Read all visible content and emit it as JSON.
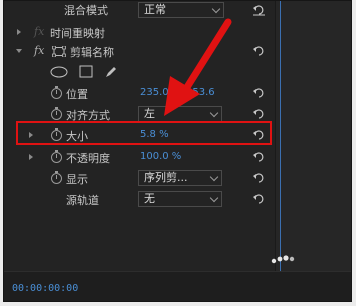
{
  "rows": {
    "blend": {
      "label": "混合模式",
      "value": "正常"
    },
    "time_remap": {
      "label": "时间重映射"
    },
    "clip_name": {
      "label": "剪辑名称"
    },
    "position": {
      "label": "位置",
      "x": "235.0",
      "y": "253.6"
    },
    "align": {
      "label": "对齐方式",
      "value": "左"
    },
    "size": {
      "label": "大小",
      "value": "5.8 %"
    },
    "opacity": {
      "label": "不透明度",
      "value": "100.0 %"
    },
    "display": {
      "label": "显示",
      "value": "序列剪..."
    },
    "source_track": {
      "label": "源轨道",
      "value": "无"
    }
  },
  "timeline": {
    "timecode": "00:00:00:00"
  },
  "colors": {
    "panel_bg": "#232323",
    "value_blue": "#4a8fd6",
    "highlight_red": "#e01212",
    "text": "#c8c8c8"
  },
  "icons": [
    "stopwatch-icon",
    "reset-icon",
    "ellipse-mask-icon",
    "rectangle-mask-icon",
    "pen-mask-icon",
    "text-layer-icon",
    "fx-icon"
  ]
}
